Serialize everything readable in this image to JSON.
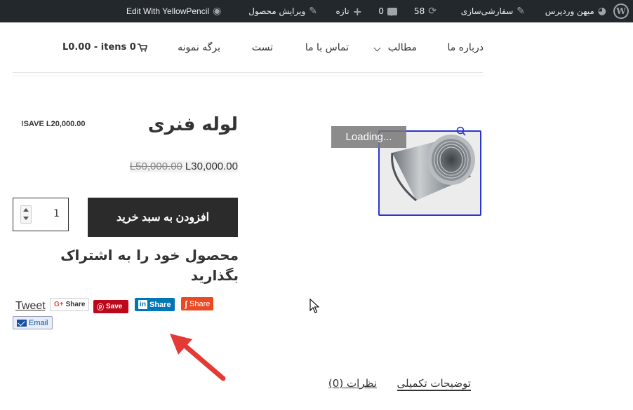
{
  "admin_bar": {
    "wp_logo": "W",
    "site_name": "میهن وردپرس",
    "customize": "سفارشی‌سازی",
    "updates_count": "58",
    "comments_count": "0",
    "new": "تازه",
    "edit_product": "ویرایش محصول",
    "yellowpencil": "Edit With YellowPencil"
  },
  "nav": {
    "about": "درباره ما",
    "posts": "مطالب",
    "contact": "تماس با ما",
    "test": "تست",
    "sample_page": "برگه نمونه",
    "cart": "L0.00 - itens 0"
  },
  "product": {
    "title": "لوله فنری",
    "save_badge": "!SAVE L20,000.00",
    "price_old": "L50,000.00",
    "price_new": "L30,000.00",
    "quantity": "1",
    "add_to_cart": "افزودن به سبد خرید",
    "loading": "Loading...",
    "share_heading": "محصول خود را به اشتراک بگذارید"
  },
  "share": {
    "tweet": "Tweet",
    "gplus_icon": "G+",
    "gplus": "Share",
    "pinterest": "Save",
    "linkedin_icon": "in",
    "linkedin": "Share",
    "stumbleupon": "Share",
    "email": "Email"
  },
  "tabs": {
    "description": "توضیحات تکمیلی",
    "reviews": "نظرات (0)"
  },
  "colors": {
    "admin_bar_bg": "#23282d",
    "button_bg": "#2b2b2b",
    "image_border": "#2b37c7",
    "arrow": "#e53935"
  }
}
